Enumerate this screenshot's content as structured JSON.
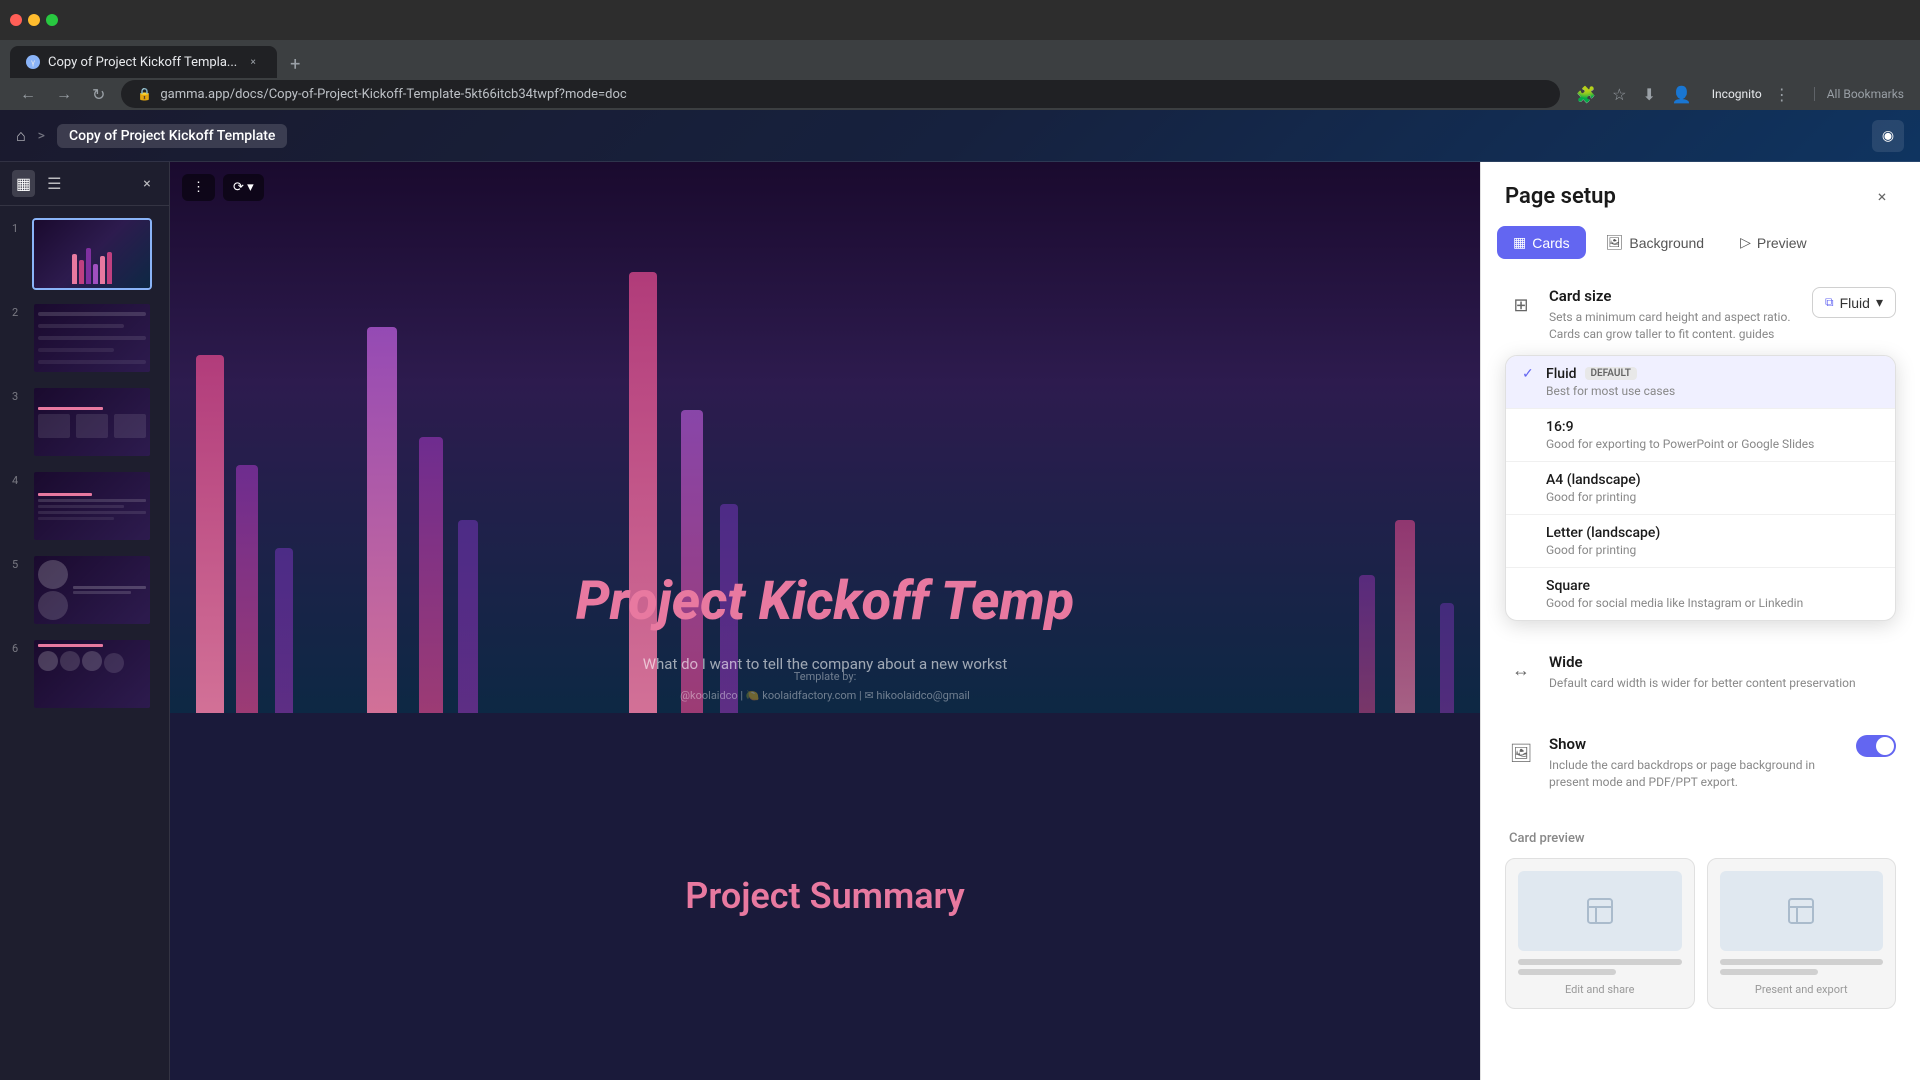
{
  "browser": {
    "tab_title": "Copy of Project Kickoff Templa...",
    "url": "gamma.app/docs/Copy-of-Project-Kickoff-Template-5kt66itcb34twpf?mode=doc",
    "new_tab_label": "+",
    "back_btn": "←",
    "forward_btn": "→",
    "refresh_btn": "↻",
    "incognito_label": "Incognito",
    "bookmarks_label": "All Bookmarks"
  },
  "app_header": {
    "home_icon": "⌂",
    "breadcrumb_sep": ">",
    "breadcrumb_title": "Copy of Project Kickoff Template",
    "header_btn_icon": "◉"
  },
  "sidebar": {
    "close_icon": "×",
    "grid_icon": "▦",
    "list_icon": "☰",
    "slide_numbers": [
      "1",
      "2",
      "3",
      "4",
      "5",
      "6"
    ],
    "slide_colors": [
      [
        "#e879a0",
        "#c04080",
        "#8030a0",
        "#a050c0",
        "#6030a0"
      ],
      [
        "#e879a0",
        "#8030a0",
        "#c04080",
        "#6030a0",
        "#a050c0"
      ],
      [
        "#e879a0",
        "#c04080",
        "#8030a0",
        "#a050c0",
        "#6030a0"
      ],
      [
        "#e879a0",
        "#c04080",
        "#8030a0",
        "#6030a0",
        "#a050c0"
      ],
      [
        "#e879a0",
        "#8030a0",
        "#c04080",
        "#6030a0",
        "#a050c0"
      ],
      [
        "#e879a0",
        "#c04080",
        "#8030a0",
        "#a050c0",
        "#6030a0"
      ]
    ]
  },
  "slide": {
    "toolbar_icon": "⋮",
    "toolbar_icon2": "⟳",
    "title": "Project Kickoff Temp",
    "subtitle": "What do I want to tell the company about a new workst",
    "template_by": "Template by:",
    "footer": "@koolaidco | 🍋 koolaidfactory.com | ✉ hikoolaidco@gmail",
    "summary_title": "Project Summary"
  },
  "panel": {
    "title": "Page setup",
    "close_icon": "×",
    "tabs": [
      {
        "id": "cards",
        "label": "Cards",
        "icon": "▦",
        "active": true
      },
      {
        "id": "background",
        "label": "Background",
        "icon": "🖼"
      },
      {
        "id": "preview",
        "label": "Preview",
        "icon": "▷"
      }
    ],
    "card_size": {
      "icon": "⊞",
      "title": "Card size",
      "desc": "Sets a minimum card height and aspect ratio. Cards can grow taller to fit content. guides",
      "selected": "Fluid",
      "dropdown_arrow": "▾"
    },
    "dropdown_items": [
      {
        "id": "fluid",
        "name": "Fluid",
        "badge": "DEFAULT",
        "desc": "Best for most use cases",
        "selected": true
      },
      {
        "id": "16-9",
        "name": "16:9",
        "badge": "",
        "desc": "Good for exporting to PowerPoint or Google Slides",
        "selected": false
      },
      {
        "id": "a4",
        "name": "A4 (landscape)",
        "badge": "",
        "desc": "Good for printing",
        "selected": false
      },
      {
        "id": "letter",
        "name": "Letter (landscape)",
        "badge": "",
        "desc": "Good for printing",
        "selected": false
      },
      {
        "id": "square",
        "name": "Square",
        "badge": "",
        "desc": "Good for social media like Instagram or Linkedin",
        "selected": false
      }
    ],
    "wide_section": {
      "icon": "↔",
      "title": "Wide",
      "desc": "Default card width is wider for better content preservation"
    },
    "show_backdrop": {
      "icon": "🖼",
      "title": "Show",
      "desc": "Include the card backdrops or page background in present mode and PDF/PPT export."
    },
    "card_preview": {
      "title": "Card preview",
      "edit_label": "Edit and share",
      "present_label": "Present and export"
    }
  }
}
